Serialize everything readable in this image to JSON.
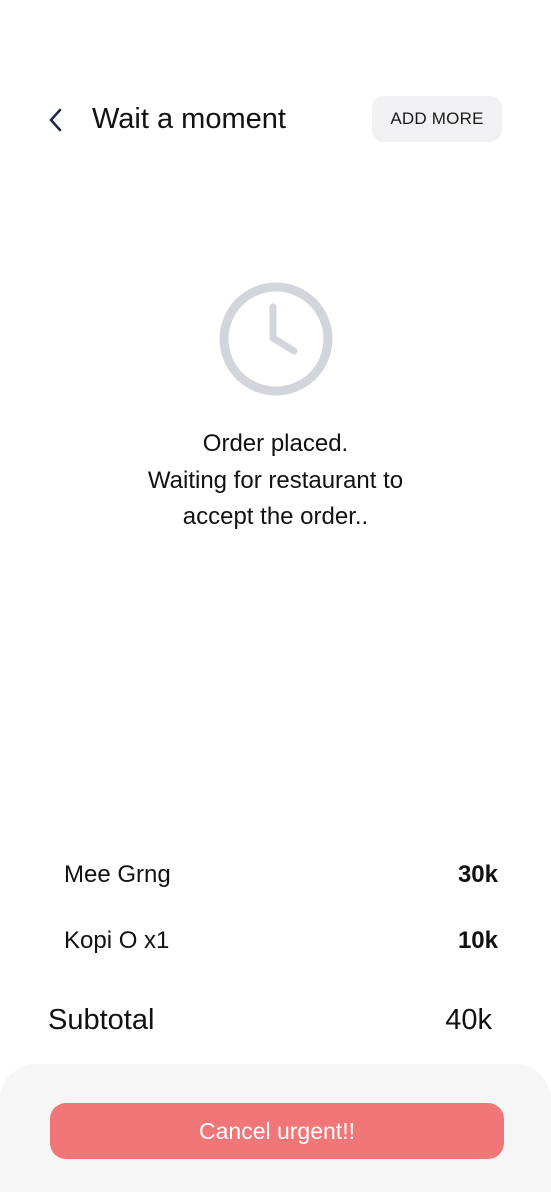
{
  "header": {
    "title": "Wait a moment",
    "add_more_label": "ADD MORE",
    "back_icon": "chevron-left-icon"
  },
  "status": {
    "icon": "clock-icon",
    "lines": [
      "Order placed.",
      "Waiting for restaurant to",
      "accept the order.."
    ]
  },
  "order": {
    "items": [
      {
        "name": "Mee Grng",
        "price": "30k"
      },
      {
        "name": "Kopi O x1",
        "price": "10k"
      }
    ],
    "subtotal_label": "Subtotal",
    "subtotal_value": "40k"
  },
  "actions": {
    "cancel_label": "Cancel urgent!!"
  },
  "colors": {
    "accent": "#f07678",
    "icon_gray": "#d3d5dd",
    "back_icon": "#1f2a4d",
    "add_more_bg": "#f1f1f3",
    "sheet_bg": "#f6f6f6"
  }
}
